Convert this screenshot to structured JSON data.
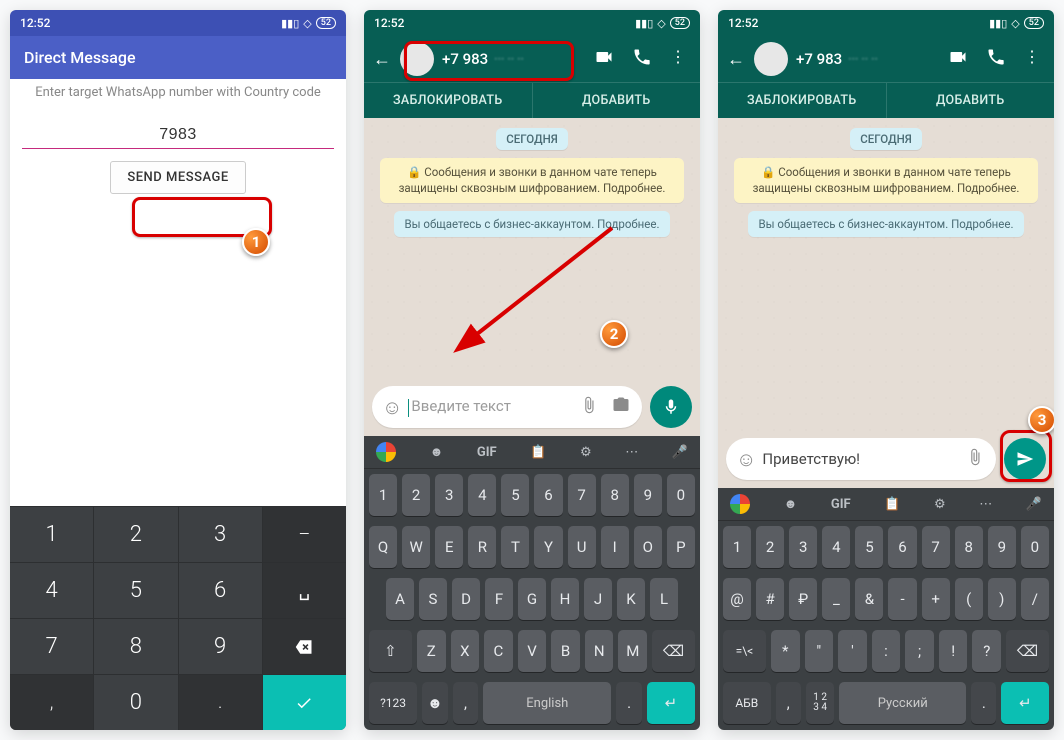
{
  "time": "12:52",
  "battery": "52",
  "panel1": {
    "title": "Direct Message",
    "hint": "Enter target WhatsApp number with Country code",
    "number": "7983",
    "send": "SEND MESSAGE",
    "keypad": {
      "rows": [
        [
          "1",
          "2",
          "3",
          "–"
        ],
        [
          "4",
          "5",
          "6",
          "␣"
        ],
        [
          "7",
          "8",
          "9",
          "⌫"
        ],
        [
          ",",
          "0",
          ".",
          "✓"
        ]
      ]
    }
  },
  "wa": {
    "contact": "+7 983",
    "block": "ЗАБЛОКИРОВАТЬ",
    "add": "ДОБАВИТЬ",
    "today": "СЕГОДНЯ",
    "encryption": "Сообщения и звонки в данном чате теперь защищены сквозным шифрованием. Подробнее.",
    "business": "Вы общаетесь с бизнес-аккаунтом. Подробнее.",
    "placeholder": "Введите текст",
    "typed": "Приветствую!"
  },
  "kb2": {
    "top": [
      "G",
      "✎",
      "GIF",
      "📋",
      "⚙",
      "⋯",
      "🎤"
    ],
    "row_digits": [
      "1",
      "2",
      "3",
      "4",
      "5",
      "6",
      "7",
      "8",
      "9",
      "0"
    ],
    "row_q": [
      "Q",
      "W",
      "E",
      "R",
      "T",
      "Y",
      "U",
      "I",
      "O",
      "P"
    ],
    "row_a": [
      "A",
      "S",
      "D",
      "F",
      "G",
      "H",
      "J",
      "K",
      "L"
    ],
    "row_z": [
      "⇧",
      "Z",
      "X",
      "C",
      "V",
      "B",
      "N",
      "M",
      "⌫"
    ],
    "row_bot": [
      "?123",
      "☻",
      ",",
      "English",
      ".",
      "↵"
    ]
  },
  "kb3": {
    "row_digits": [
      "1",
      "2",
      "3",
      "4",
      "5",
      "6",
      "7",
      "8",
      "9",
      "0"
    ],
    "row_sym1": [
      "@",
      "#",
      "₽",
      "_",
      "&",
      "-",
      "+",
      "(",
      ")",
      "/"
    ],
    "row_sym2": [
      "=\\<",
      "*",
      "\"",
      "'",
      ":",
      ";",
      "!",
      "?",
      "⌫"
    ],
    "row_bot": [
      "АБВ",
      ",",
      "1234",
      "Русский",
      ".",
      "↵"
    ]
  },
  "steps": {
    "s1": "1",
    "s2": "2",
    "s3": "3"
  }
}
